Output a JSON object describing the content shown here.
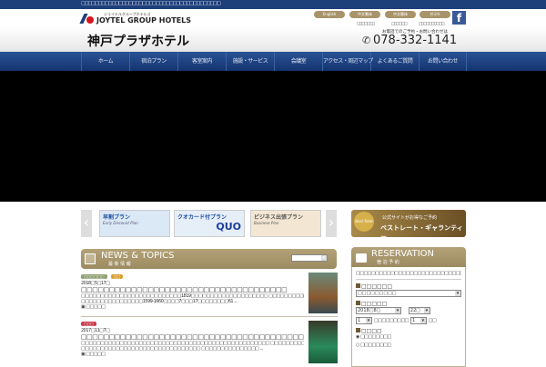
{
  "topbar": {
    "text": "□□□□□□□□□□□□□□□□□□□□□□□□□□□□□□□□□□□□□□□□□"
  },
  "logo": {
    "kana": "ジョイテルグループホテルズ",
    "name": "JOYTEL GROUP HOTELS"
  },
  "header": {
    "title": "神戸プラザホテル",
    "phone_note": "お電話でのご予約・お問い合わせは",
    "phone": "078-332-1141"
  },
  "languages": [
    "English",
    "中文繁体",
    "中文簡体",
    "한국어"
  ],
  "sublinks": [
    "□□□□□□□",
    "□□□□□□",
    "□□□□□□□□□□"
  ],
  "facebook": "f",
  "nav": [
    "ホーム",
    "宿泊プラン",
    "客室案内",
    "施設・サービス",
    "会議室",
    "アクセス・周辺マップ",
    "よくあるご質問",
    "お問い合わせ"
  ],
  "banners": [
    {
      "title": "早割プラン",
      "sub": "Early Discount Plan",
      "color": "#dbe8f5"
    },
    {
      "title": "クオカード付プラン",
      "sub": "QUO",
      "color": "#e6eef8"
    },
    {
      "title": "ビジネス出張プラン",
      "sub": "Business Plan",
      "color": "#f3e6d2"
    }
  ],
  "guarantee": {
    "line1": "公式サイトがお得なご予約",
    "line2": "ベストレート・ギャランティー",
    "badge": "Best Rate"
  },
  "news": {
    "title": "NEWS & TOPICS",
    "subtitle": "最 新 情 報",
    "filter": "□□□□",
    "items": [
      {
        "tags": [
          {
            "text": "□□□□□□",
            "color": "#8fa070"
          },
          {
            "text": "□□",
            "color": "#d9a030"
          }
        ],
        "date": "2018□5□17□",
        "title": "□□□□□□□□□□□□□□□□□□□□□□□□□□□□□□□□□□□□□",
        "body1": "□□□□□□□□□□□□□□□□□□□□□□□□□□1819□□□□□□□□□□□□□□□□□□□□ □□□□□□□□□□□□□□□□□□□□□□□□□□□",
        "body2": "□□□□□□□□□□□□□□□□1599-1660□□□□7□□□17□□□□□□□□61 ...",
        "more": "□□□□□"
      },
      {
        "tags": [
          {
            "text": "□□□",
            "color": "#c8404e"
          }
        ],
        "date": "2017□11□7□",
        "title": "□□□□□□□□□□□□□□□□□□□□□□□□□□□□□□□□□□□□□□□□□□□□□□□□□□□□□□□□□□□",
        "body1": "□□□□□□□□□□□□□□□□□□□□□□□□□□□□□□□□□□□□□□□□□□□□□□□□□ □□□□□□□□□□□□□□□□□□□□□□□□",
        "body2": "□□□□□□□□□□□□□□□□□□□□□□□□□□□□□□□ □□□□□□□□□□□□□□□ ...",
        "more": "□□□□□"
      }
    ]
  },
  "reservation": {
    "title": "RESERVATION",
    "subtitle": "宿 泊 予 約",
    "intro": "□□□□□□□□□□□□□□□□□□□□□□□□□□□□",
    "hotel_label": "□□□□□□",
    "hotel_value": "□□□□□□□□□",
    "date_label": "□□□□□",
    "month": "2018□8□",
    "day": "22□",
    "nights": "1",
    "nights_text": "□□□□□□□□□",
    "rooms": "1",
    "rooms_suffix": "□□",
    "type_label": "□□□□",
    "options": [
      "□□□□□□□□",
      "□□□□□□□□"
    ]
  }
}
